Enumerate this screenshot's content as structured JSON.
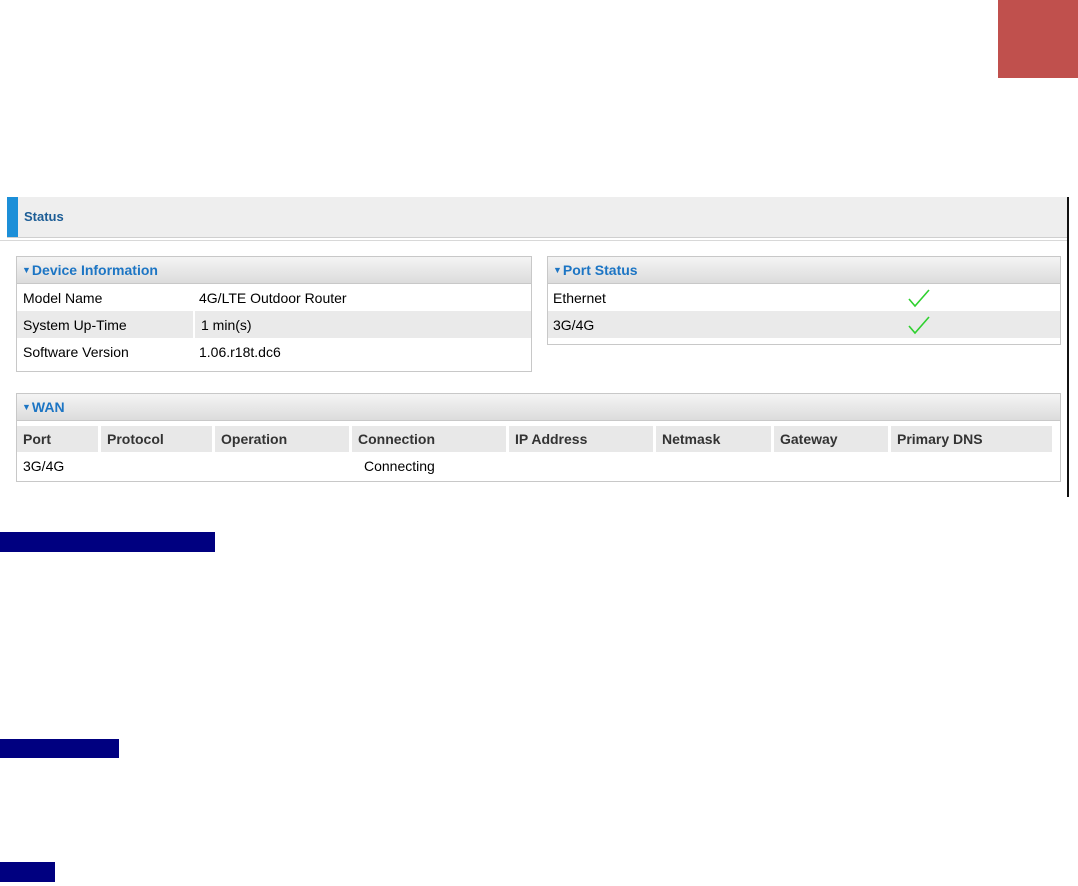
{
  "colors": {
    "corner_block": "#c0504d",
    "accent": "#1c8fd8",
    "highlight": "#000080",
    "check": "#2fd12f"
  },
  "status": {
    "title": "Status"
  },
  "device_info": {
    "title": "Device Information",
    "rows": [
      {
        "label": "Model Name",
        "value": "4G/LTE Outdoor Router"
      },
      {
        "label": "System Up-Time",
        "value": "1 min(s)"
      },
      {
        "label": "Software Version",
        "value": "1.06.r18t.dc6"
      }
    ]
  },
  "port_status": {
    "title": "Port Status",
    "rows": [
      {
        "label": "Ethernet",
        "icon": "check-icon"
      },
      {
        "label": "3G/4G",
        "icon": "check-icon"
      }
    ]
  },
  "wan": {
    "title": "WAN",
    "columns": [
      "Port",
      "Protocol",
      "Operation",
      "Connection",
      "IP Address",
      "Netmask",
      "Gateway",
      "Primary DNS"
    ],
    "rows": [
      [
        "3G/4G",
        "",
        "",
        "Connecting",
        "",
        "",
        "",
        ""
      ]
    ]
  }
}
